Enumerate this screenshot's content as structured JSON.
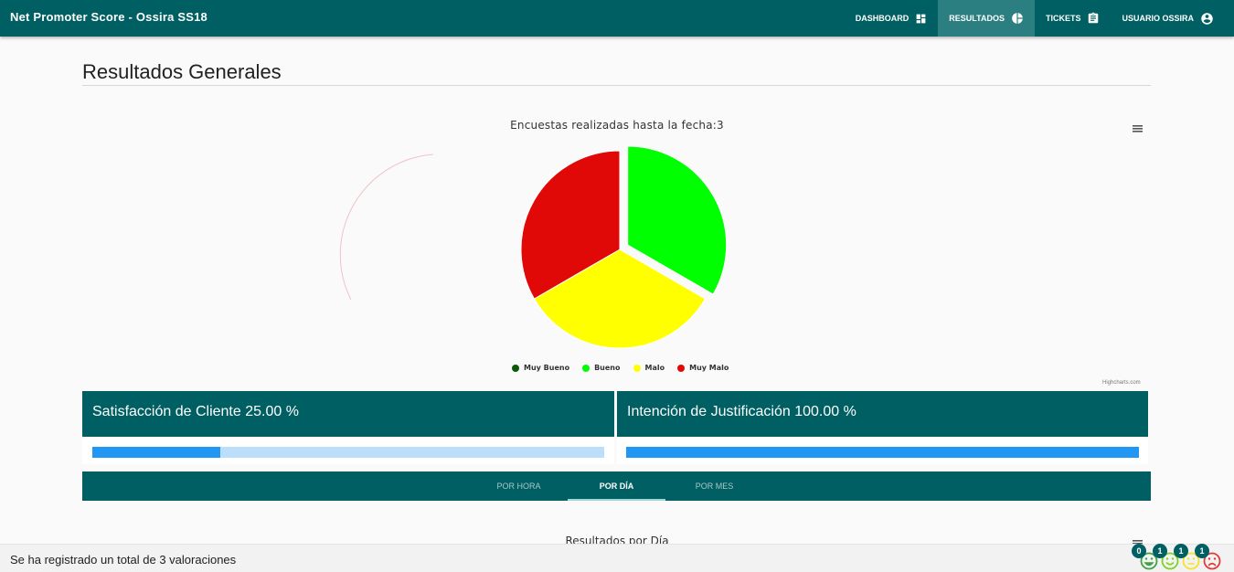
{
  "app": {
    "title": "Net Promoter Score - Ossira SS18"
  },
  "nav": [
    {
      "label": "DASHBOARD",
      "icon": "dashboard-icon"
    },
    {
      "label": "RESULTADOS",
      "icon": "pie-chart-icon",
      "active": true
    },
    {
      "label": "TICKETS",
      "icon": "clipboard-icon"
    },
    {
      "label": "USUARIO OSSIRA",
      "icon": "account-circle-icon"
    }
  ],
  "page": {
    "title": "Resultados Generales"
  },
  "chart_data": {
    "type": "pie",
    "title": "Encuestas realizadas hasta la fecha:3",
    "categories": [
      "Muy Bueno",
      "Bueno",
      "Malo",
      "Muy Malo"
    ],
    "values": [
      0,
      1,
      1,
      1
    ],
    "colors": [
      "#0a5a0a",
      "#00ff00",
      "#ffff00",
      "#e10808"
    ],
    "legend_position": "bottom",
    "credits": "Highcharts.com"
  },
  "stats": {
    "satisfaction": {
      "label": "Satisfacción de Cliente 25.00 %",
      "value": 25
    },
    "justification": {
      "label": "Intención de Justificación 100.00 %",
      "value": 100
    }
  },
  "tabs": [
    {
      "label": "POR HORA"
    },
    {
      "label": "POR DÍA",
      "active": true
    },
    {
      "label": "POR MES"
    }
  ],
  "sub_chart": {
    "title": "Resultados por Día"
  },
  "footer": {
    "text": "Se ha registrado un total de 3 valoraciones",
    "ratings": [
      {
        "icon": "very-happy-face-icon",
        "count": "0",
        "color": "#43a047"
      },
      {
        "icon": "happy-face-icon",
        "count": "1",
        "color": "#7ed321"
      },
      {
        "icon": "neutral-face-icon",
        "count": "1",
        "color": "#f5e22a"
      },
      {
        "icon": "sad-face-icon",
        "count": "1",
        "color": "#e53935"
      }
    ]
  }
}
